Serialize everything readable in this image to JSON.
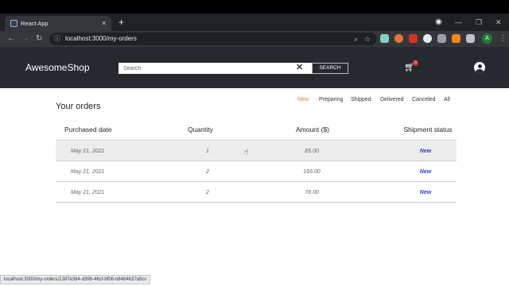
{
  "browser": {
    "tab_title": "React App",
    "url": "localhost:3000/my-orders",
    "profile_initial": "A",
    "status_url": "localhost:3000/my-orders/1387e384-d398-46cf-bf06-b8464b37a5cc"
  },
  "navbar": {
    "brand": "AwesomeShop",
    "search_placeholder": "Search",
    "search_button": "SEARCH",
    "cart_count": "0",
    "icons": {
      "cart": "cart-icon",
      "user": "user-circle-icon",
      "clear": "close-icon"
    }
  },
  "orders": {
    "title": "Your orders",
    "filters": [
      "New",
      "Preparing",
      "Shipped",
      "Delivered",
      "Canceled",
      "All"
    ],
    "active_filter": "New",
    "columns": [
      "Purchased date",
      "Quantity",
      "Amount ($)",
      "Shipment status"
    ],
    "rows": [
      {
        "date": "May 21, 2021",
        "quantity": "1",
        "amount": "85.00",
        "status": "New"
      },
      {
        "date": "May 21, 2021",
        "quantity": "2",
        "amount": "166.00",
        "status": "New"
      },
      {
        "date": "May 21, 2021",
        "quantity": "2",
        "amount": "78.00",
        "status": "New"
      }
    ]
  },
  "colors": {
    "navbar_bg": "#262a2f",
    "active_filter": "#e07b39",
    "status_new": "#2a3fd1",
    "highlight_row": "#ececec"
  }
}
